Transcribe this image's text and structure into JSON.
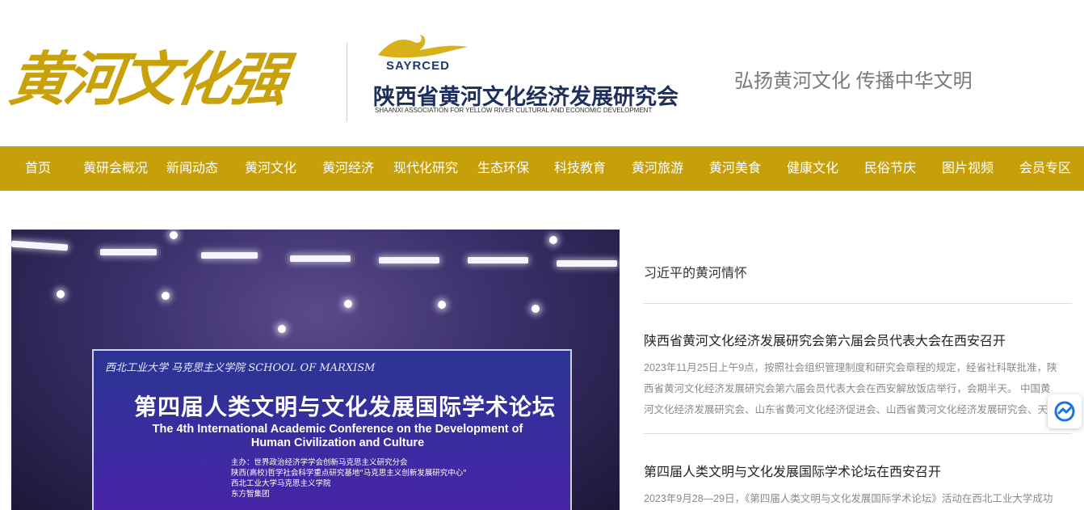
{
  "header": {
    "logo_calligraphy": "黄河文化强",
    "org_abbr": "SAYRCED",
    "org_name": "陕西省黄河文化经济发展研究会",
    "org_name_en": "SHAANXI ASSOCIATION FOR YELLOW RIVER CULTURAL AND ECONOMIC DEVELOPMENT",
    "slogan": "弘扬黄河文化 传播中华文明"
  },
  "nav": {
    "items": [
      {
        "label": "首页"
      },
      {
        "label": "黄研会概况"
      },
      {
        "label": "新闻动态"
      },
      {
        "label": "黄河文化"
      },
      {
        "label": "黄河经济"
      },
      {
        "label": "现代化研究"
      },
      {
        "label": "生态环保"
      },
      {
        "label": "科技教育"
      },
      {
        "label": "黄河旅游"
      },
      {
        "label": "黄河美食"
      },
      {
        "label": "健康文化"
      },
      {
        "label": "民俗节庆"
      },
      {
        "label": "图片视频"
      },
      {
        "label": "会员专区"
      }
    ]
  },
  "feature": {
    "banner_logos": "西北工业大学   马克思主义学院 SCHOOL OF MARXISM",
    "banner_title_cn": "第四届人类文明与文化发展国际学术论坛",
    "banner_title_en": "The 4th International Academic Conference on the Development of Human Civilization and Culture",
    "sponsors": [
      "主办：世界政治经济学学会创新马克思主义研究分会",
      "陕西(高校)哲学社会科学重点研究基地\"马克思主义创新发展研究中心\"",
      "西北工业大学马克思主义学院",
      "东方智集团"
    ]
  },
  "news": {
    "top_link": "习近平的黄河情怀",
    "items": [
      {
        "title": "陕西省黄河文化经济发展研究会第六届会员代表大会在西安召开",
        "excerpt": "2023年11月25日上午9点，按照社会组织管理制度和研究会章程的规定，经省社科联批准，陕西省黄河文化经济发展研究会第六届会员代表大会在西安解放饭店举行，会期半天。 中国黄河文化经济发展研究会、山东省黄河文化经济促进会、山西省黄河文化经济发展研究会、天"
      },
      {
        "title": "第四届人类文明与文化发展国际学术论坛在西安召开",
        "excerpt": "2023年9月28—29日，《第四届人类文明与文化发展国际学术论坛》活动在西北工业大学成功"
      }
    ]
  },
  "colors": {
    "brand_gold": "#c6a00b",
    "org_navy": "#1d2f5a"
  }
}
